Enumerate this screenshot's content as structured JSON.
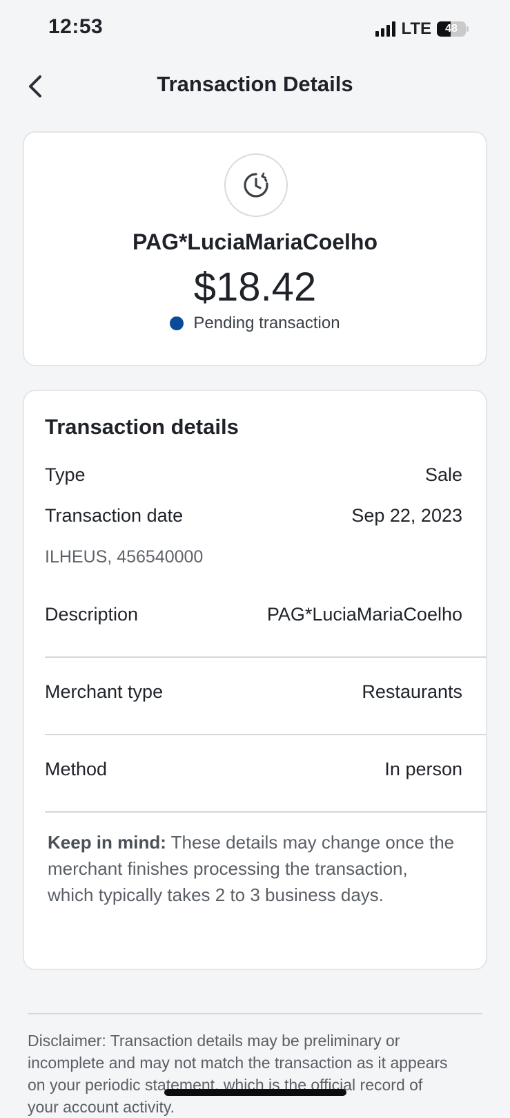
{
  "status_bar": {
    "time": "12:53",
    "network": "LTE",
    "battery": "48",
    "battery_level": 0.48
  },
  "nav": {
    "title": "Transaction Details"
  },
  "summary": {
    "merchant": "PAG*LuciaMariaCoelho",
    "amount": "$18.42",
    "status": "Pending transaction",
    "status_color": "#0b4a99"
  },
  "details": {
    "title": "Transaction details",
    "rows": [
      {
        "label": "Type",
        "value": "Sale"
      },
      {
        "label": "Transaction date",
        "value": "Sep 22, 2023"
      }
    ],
    "location": "ILHEUS, 456540000",
    "description": {
      "label": "Description",
      "value": "PAG*LuciaMariaCoelho"
    },
    "merchant_type": {
      "label": "Merchant type",
      "value": "Restaurants"
    },
    "method": {
      "label": "Method",
      "value": "In person"
    },
    "note_bold": "Keep in mind:",
    "note_text": " These details may change once the merchant finishes processing the transaction, which typically takes 2 to 3 business days."
  },
  "disclaimer": "Disclaimer: Transaction details may be preliminary or incomplete and may not match the transaction as it appears on your periodic statement, which is the official record of your account activity."
}
